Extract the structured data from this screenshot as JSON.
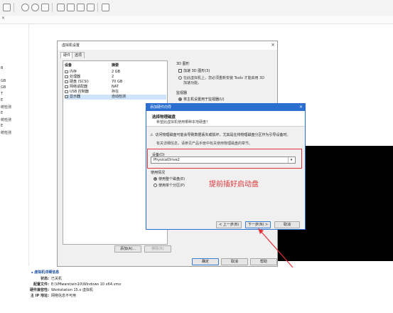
{
  "left_pane": {
    "items": [
      "B",
      "GB",
      "GB",
      "T",
      "E",
      "统检测",
      "E",
      "统检测",
      "E",
      "统检测"
    ]
  },
  "settings": {
    "title": "虚拟机设置",
    "tabs": [
      "硬件",
      "选项"
    ],
    "columns": {
      "device": "设备",
      "summary": "摘要"
    },
    "devices": [
      {
        "name": "内存",
        "summary": "2 GB"
      },
      {
        "name": "处理器",
        "summary": "2"
      },
      {
        "name": "硬盘 (SCSI)",
        "summary": "70 GB"
      },
      {
        "name": "网络适配器",
        "summary": "NAT"
      },
      {
        "name": "USB 控制器",
        "summary": "存在"
      },
      {
        "name": "显示器",
        "summary": "自动检测"
      }
    ],
    "display3d": {
      "group": "3D 图形",
      "accel": "加速 3D 图形(3)",
      "warning_line1": "在此虚拟机上，您必须重新安装 Tools 才能启用 3D",
      "warning_line2": "加速功能。"
    },
    "monitor": {
      "group": "监视器",
      "option": "将主机设置用于监视器(U)"
    },
    "add_button": "添加(A)...",
    "remove_button": "移除(R)",
    "ok_button": "确定",
    "cancel_button": "取消",
    "help_button": "帮助"
  },
  "wizard": {
    "title": "添加硬件向导",
    "heading": "选择物理磁盘",
    "subheading": "希望此虚拟机使用哪种本地硬盘？",
    "warning": "访问物理磁盘可能会导致数据丢失或损坏，尤其是在将物理磁盘分区作为引导设备时。",
    "info": "有关详细信息，请参见产品手册中有关使用物理磁盘的章节。",
    "device_label": "设备(D)",
    "device_value": "PhysicalDrive2",
    "usage_label": "使用情况",
    "usage_options": [
      "使用整个磁盘(E)",
      "使用单个分区(P)"
    ],
    "back_button": "< 上一步(B)",
    "next_button": "下一步(N) >",
    "cancel_button": "取消"
  },
  "annotation": {
    "text": "提前插好启动盘",
    "color": "#e0353a"
  },
  "details": {
    "header": "虚拟机详细信息",
    "rows": [
      {
        "key": "状态:",
        "value": "已关机"
      },
      {
        "key": "配置文件:",
        "value": "E:\\VMware\\win10\\Windows 10 x64.vmx"
      },
      {
        "key": "硬件兼容性:",
        "value": "Workstation 15.x 虚拟机"
      },
      {
        "key": "主 IP 地址:",
        "value": "网络信息不可用"
      }
    ]
  }
}
